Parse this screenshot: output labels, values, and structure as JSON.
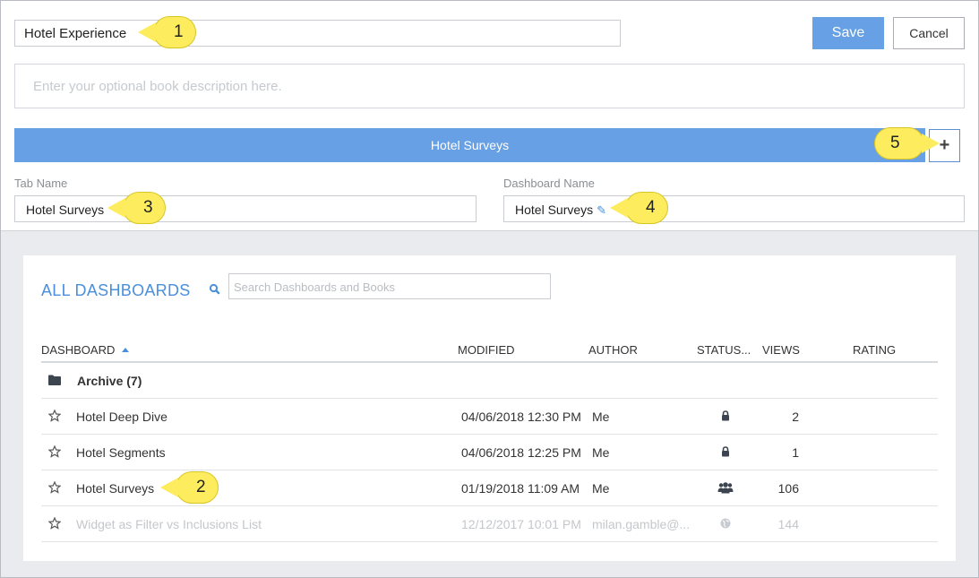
{
  "book": {
    "title": "Hotel Experience",
    "description_placeholder": "Enter your optional book description here.",
    "save_label": "Save",
    "cancel_label": "Cancel"
  },
  "tabs": [
    {
      "label": "Hotel Surveys"
    }
  ],
  "add_tab_label": "+",
  "tab_settings": {
    "tab_name_label": "Tab Name",
    "tab_name_value": "Hotel Surveys",
    "dashboard_name_label": "Dashboard Name",
    "dashboard_name_value": "Hotel Surveys"
  },
  "callouts": [
    "1",
    "2",
    "3",
    "4",
    "5"
  ],
  "dashboards": {
    "title": "ALL DASHBOARDS",
    "search_placeholder": "Search Dashboards and Books",
    "columns": {
      "dashboard": "DASHBOARD",
      "modified": "MODIFIED",
      "author": "AUTHOR",
      "status": "STATUS...",
      "views": "VIEWS",
      "rating": "RATING"
    },
    "folder": {
      "label": "Archive (7)",
      "icon": "folder-icon"
    },
    "rows": [
      {
        "name": "Hotel Deep Dive",
        "modified": "04/06/2018 12:30 PM",
        "author": "Me",
        "status_icon": "lock-icon",
        "views": "2"
      },
      {
        "name": "Hotel Segments",
        "modified": "04/06/2018 12:25 PM",
        "author": "Me",
        "status_icon": "lock-icon",
        "views": "1"
      },
      {
        "name": "Hotel Surveys",
        "modified": "01/19/2018 11:09 AM",
        "author": "Me",
        "status_icon": "group-icon",
        "views": "106"
      },
      {
        "name": "Widget as Filter vs Inclusions List",
        "modified": "12/12/2017 10:01 PM",
        "author": "milan.gamble@...",
        "status_icon": "globe-icon",
        "views": "144"
      }
    ]
  },
  "colors": {
    "accent": "#67a0e4",
    "link": "#4a8fdc",
    "callout": "#fcec5e"
  }
}
